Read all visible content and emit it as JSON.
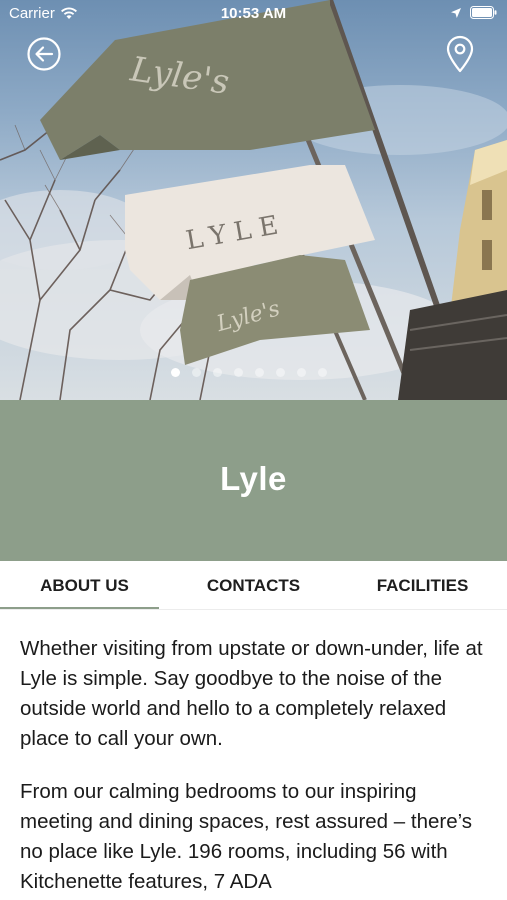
{
  "status_bar": {
    "carrier": "Carrier",
    "time": "10:53 AM"
  },
  "hero": {
    "image_description_icon": "flags-photo",
    "flag_text_1": "Lyle's",
    "flag_text_2": "LYLE",
    "flag_text_3": "Lyle's",
    "carousel_count": 8,
    "carousel_active_index": 0
  },
  "header": {
    "back_icon": "back-arrow-circle-icon",
    "map_icon": "map-pin-icon"
  },
  "hotel": {
    "name": "Lyle"
  },
  "tabs": [
    {
      "label": "ABOUT US",
      "active": true
    },
    {
      "label": "CONTACTS",
      "active": false
    },
    {
      "label": "FACILITIES",
      "active": false
    }
  ],
  "about": {
    "paragraphs": [
      "Whether visiting from upstate or down-under, life at Lyle is simple. Say goodbye to the noise of the outside world and hello to a completely relaxed place to call your own.",
      "From our calming bedrooms to our inspiring meeting and dining spaces, rest assured – there’s no place like Lyle. 196 rooms, including 56 with Kitchenette features, 7 ADA"
    ]
  },
  "colors": {
    "accent_sage": "#8d9e8a",
    "text": "#1b1b1b",
    "flag_olive": "#7c7f6a",
    "flag_cream": "#ece6df"
  }
}
